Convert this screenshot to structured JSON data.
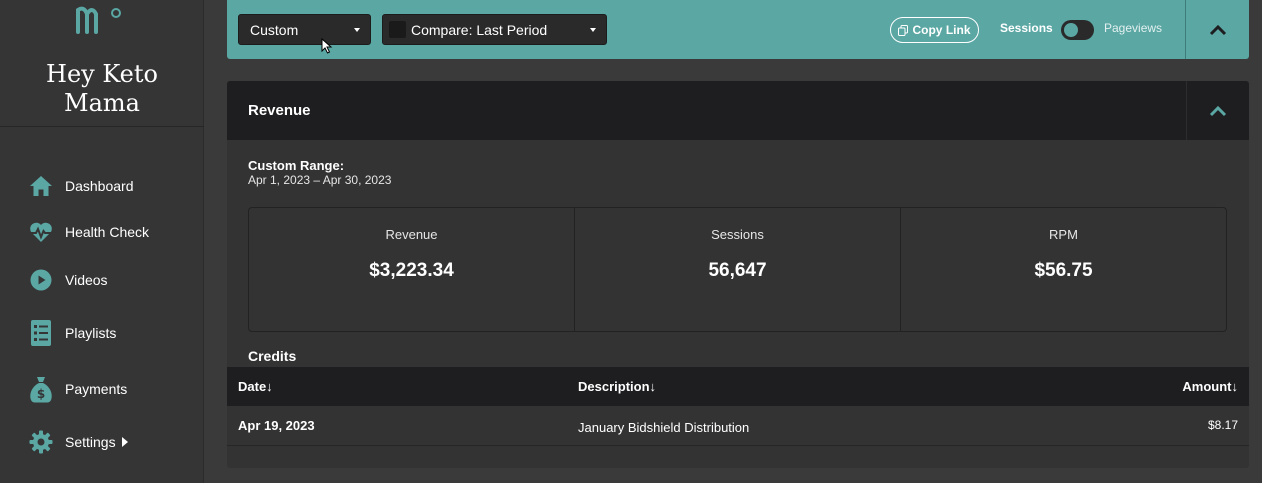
{
  "sidebar": {
    "site_name": "Hey Keto Mama",
    "items": [
      {
        "label": "Dashboard",
        "icon": "home-icon"
      },
      {
        "label": "Health Check",
        "icon": "heartbeat-icon"
      },
      {
        "label": "Videos",
        "icon": "play-icon"
      },
      {
        "label": "Playlists",
        "icon": "list-icon"
      },
      {
        "label": "Payments",
        "icon": "money-bag-icon"
      },
      {
        "label": "Settings",
        "icon": "gear-icon"
      }
    ]
  },
  "filters": {
    "range_select": "Custom",
    "compare_select": "Compare: Last Period",
    "compare_checked": false,
    "copy_link": "Copy Link",
    "toggle_left": "Sessions",
    "toggle_right": "Pageviews"
  },
  "panel": {
    "title": "Revenue",
    "range_title": "Custom Range:",
    "range_value": "Apr 1, 2023 – Apr 30, 2023",
    "stats": [
      {
        "label": "Revenue",
        "value": "$3,223.34"
      },
      {
        "label": "Sessions",
        "value": "56,647"
      },
      {
        "label": "RPM",
        "value": "$56.75"
      }
    ],
    "credits": {
      "title": "Credits",
      "columns": {
        "date": "Date↓",
        "description": "Description↓",
        "amount": "Amount↓"
      },
      "rows": [
        {
          "date": "Apr 19, 2023",
          "description": "January Bidshield Distribution",
          "amount": "$8.17"
        }
      ]
    }
  },
  "colors": {
    "accent": "#5aa7a4",
    "sidebar_bg": "#353536",
    "header_bg": "#1e1e20"
  }
}
